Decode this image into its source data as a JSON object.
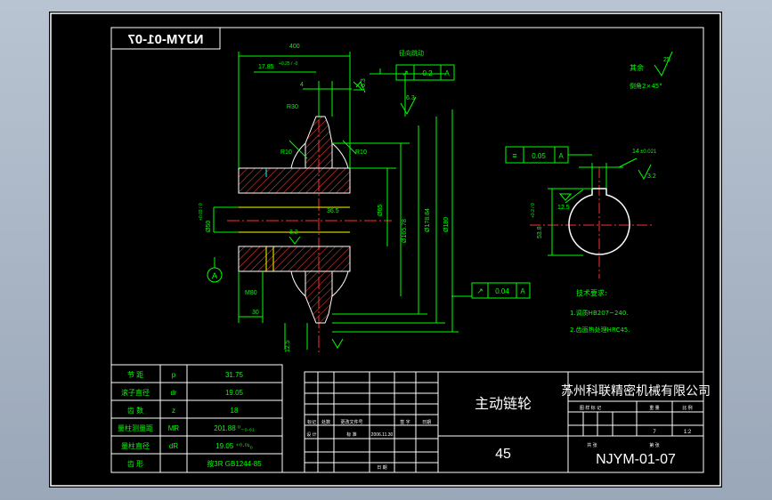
{
  "drawing": {
    "title_mirrored": "NJYM-01-07",
    "dims": {
      "d400": "400",
      "d1785": "17.85",
      "tol_1785": "+0.25 / -0",
      "d4": "4",
      "r30": "R30",
      "r10_left": "R10",
      "r10_right": "R10",
      "d165": "Ø65",
      "d16570": "Ø165.78",
      "d17884": "Ø178.84",
      "d180": "Ø180",
      "d365": "36.5",
      "d30": "30",
      "m80": "M80",
      "d50": "Ø50",
      "tol_50": "+0.03 / 0",
      "key_width": "14",
      "key_tol": "±0.021",
      "key_depth": "53.8",
      "key_depth_tol": "+0.2 / 0",
      "rough_125": "12.5",
      "rough_63": "6.3",
      "rough_32": "3.2",
      "rough_25": "25",
      "datum": "A"
    },
    "gdt_runout": {
      "caption": "径向跳动",
      "symbol": "↗",
      "value": "0.2",
      "datum": "A"
    },
    "gdt_sym": {
      "symbol": "≡",
      "value": "0.05",
      "datum": "A"
    },
    "gdt_face": {
      "symbol": "↗",
      "value": "0.04",
      "datum": "A"
    },
    "rest_note": {
      "label": "其余",
      "chamfer": "倒角2×45°"
    },
    "tech_req": {
      "title": "技术要求:",
      "lines": [
        "1.调质HB207~240.",
        "2.齿面热处理HRC45."
      ]
    }
  },
  "param_table": {
    "rows": [
      {
        "name": "节  距",
        "symbol": "p",
        "value": "31.75"
      },
      {
        "name": "滚子直径",
        "symbol": "dr",
        "value": "19.05"
      },
      {
        "name": "齿  数",
        "symbol": "z",
        "value": "18"
      },
      {
        "name": "量柱测量距",
        "symbol": "MR",
        "value": "201.88 ⁰₋₀.₆₁"
      },
      {
        "name": "量柱直径",
        "symbol": "dR",
        "value": "19.05 ⁺⁰·⁰¹₀"
      },
      {
        "name": "齿  形",
        "symbol": "",
        "value": "按3R GB1244-85"
      }
    ]
  },
  "title_block": {
    "part_name": "主动链轮",
    "material": "45",
    "company": "苏州科联精密机械有限公司",
    "drawing_no": "NJYM-01-07",
    "rev_headers": [
      "标记",
      "处数",
      "更改文件号",
      "签 字",
      "日期"
    ],
    "sign_labels": [
      "设 计",
      "标 准",
      "日 期"
    ],
    "design_date": "2006.11.30",
    "stage_headers": [
      "图 样 标 记",
      "重 量",
      "比 例"
    ],
    "weight": "7",
    "scale": "1:2",
    "sheet_labels": [
      "共 张",
      "第 张"
    ]
  }
}
